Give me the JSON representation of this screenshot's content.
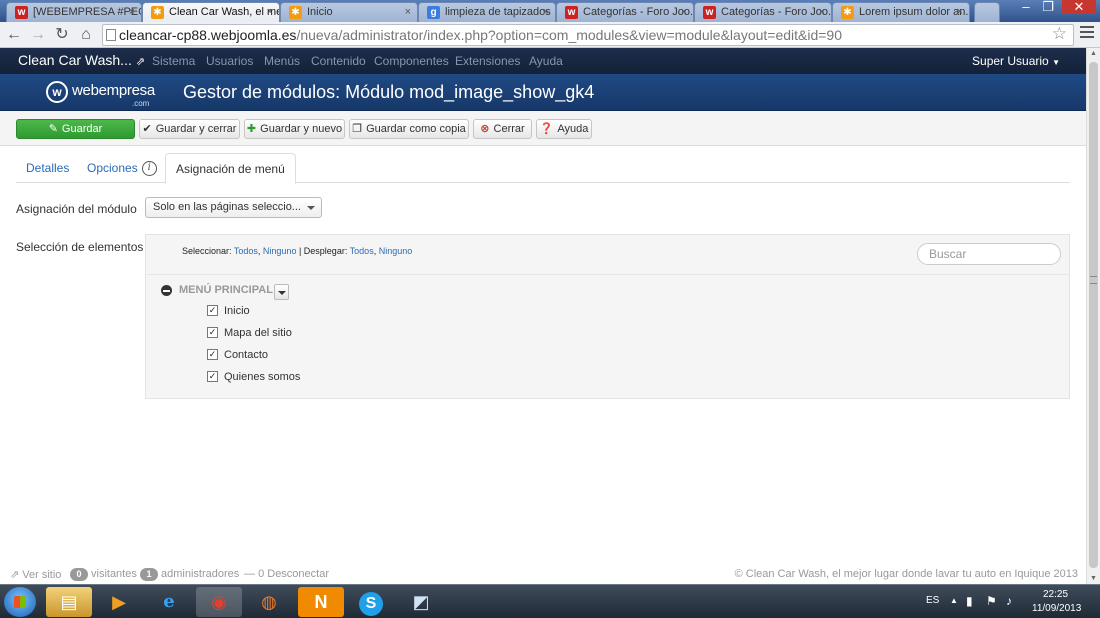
{
  "browser": {
    "tabs": [
      {
        "label": "[WEBEMPRESA #PEG...",
        "icon": "webempresa-favicon",
        "icon_color": "#cc2222"
      },
      {
        "label": "Clean Car Wash, el me...",
        "icon": "joomla-favicon",
        "icon_color": "#f39c12"
      },
      {
        "label": "Inicio",
        "icon": "joomla-favicon",
        "icon_color": "#f39c12"
      },
      {
        "label": "limpieza de tapizados",
        "icon": "google-favicon",
        "icon_color": "#3b7ddd"
      },
      {
        "label": "Categorías - Foro Joo...",
        "icon": "webempresa-favicon",
        "icon_color": "#cc2222"
      },
      {
        "label": "Categorías - Foro Joo...",
        "icon": "webempresa-favicon",
        "icon_color": "#cc2222"
      },
      {
        "label": "Lorem ipsum dolor an...",
        "icon": "joomla-favicon",
        "icon_color": "#f39c12"
      }
    ],
    "url_host": "cleancar-cp88.webjoomla.es",
    "url_path": "/nueva/administrator/index.php?option=com_modules&view=module&layout=edit&id=90"
  },
  "admin_nav": {
    "brand": "Clean Car Wash...",
    "items": [
      "Sistema",
      "Usuarios",
      "Menús",
      "Contenido",
      "Componentes",
      "Extensiones",
      "Ayuda"
    ],
    "user": "Super Usuario"
  },
  "header": {
    "logo_text": "webempresa",
    "logo_sub": ".com",
    "title": "Gestor de módulos: Módulo mod_image_show_gk4"
  },
  "actions": {
    "save": "Guardar",
    "save_close": "Guardar y cerrar",
    "save_new": "Guardar y nuevo",
    "save_copy": "Guardar como copia",
    "close": "Cerrar",
    "help": "Ayuda"
  },
  "tabs": {
    "details": "Detalles",
    "options": "Opciones",
    "menu_assignment": "Asignación de menú"
  },
  "form": {
    "module_assignment_label": "Asignación del módulo",
    "module_assignment_value": "Solo en las páginas seleccio...",
    "menu_selection_label": "Selección de elementos del menú:",
    "select_label": "Seleccionar:",
    "all": "Todos",
    "none": "Ninguno",
    "expand_label": "Desplegar:",
    "search_placeholder": "Buscar"
  },
  "menu": {
    "title": "MENÚ PRINCIPAL",
    "items": [
      {
        "label": "Inicio",
        "checked": true
      },
      {
        "label": "Mapa del sitio",
        "checked": true
      },
      {
        "label": "Contacto",
        "checked": true
      },
      {
        "label": "Quienes somos",
        "checked": true
      }
    ]
  },
  "footer": {
    "view_site": "Ver sitio",
    "visitors_count": "0",
    "visitors": "visitantes",
    "admins_count": "1",
    "admins": "administradores",
    "logout_count": "0",
    "logout": "Desconectar",
    "copyright": "© Clean Car Wash, el mejor lugar donde lavar tu auto en Iquique 2013"
  },
  "taskbar": {
    "lang": "ES",
    "time": "22:25",
    "date": "11/09/2013"
  }
}
